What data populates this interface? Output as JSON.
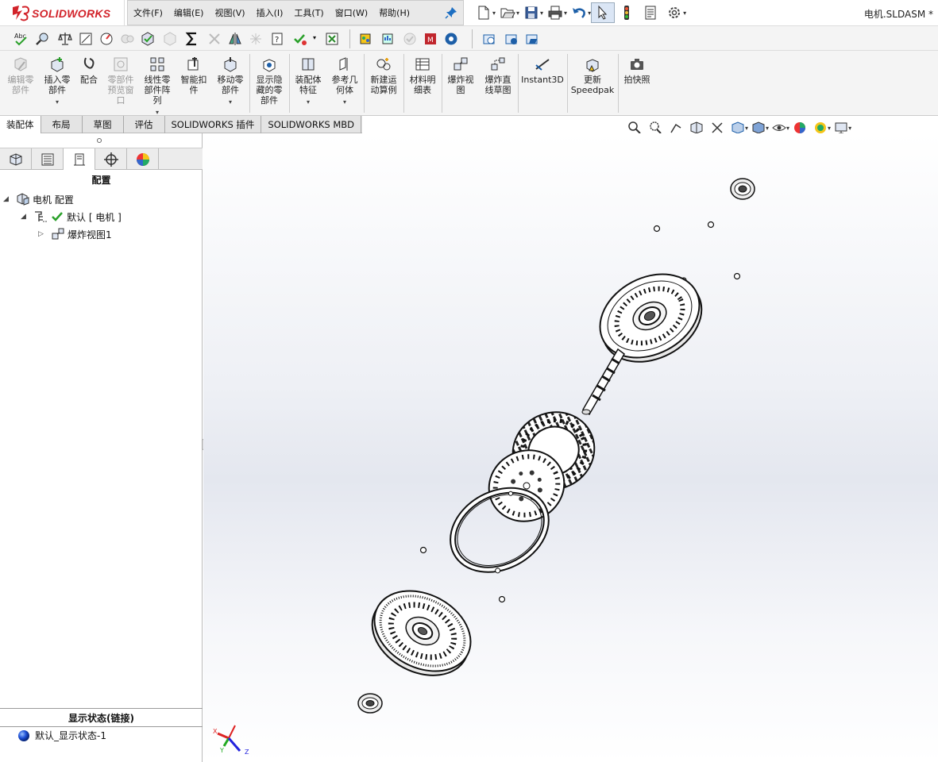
{
  "app": {
    "logo_text": "SOLIDWORKS",
    "document_title": "电机.SLDASM *"
  },
  "menu": [
    "文件(F)",
    "编辑(E)",
    "视图(V)",
    "插入(I)",
    "工具(T)",
    "窗口(W)",
    "帮助(H)"
  ],
  "quick_access": [
    "new-icon",
    "open-icon",
    "save-icon",
    "print-icon",
    "undo-icon",
    "select-icon",
    "rebuild-icon",
    "file-properties-icon",
    "options-icon"
  ],
  "ribbon": {
    "buttons": [
      {
        "label": "编辑零\n部件",
        "enabled": false
      },
      {
        "label": "插入零\n部件",
        "enabled": true,
        "dropdown": true
      },
      {
        "label": "配合",
        "enabled": true
      },
      {
        "label": "零部件\n预览窗\n口",
        "enabled": false
      },
      {
        "label": "线性零\n部件阵\n列",
        "enabled": true,
        "dropdown": true
      },
      {
        "label": "智能扣\n件",
        "enabled": true
      },
      {
        "label": "移动零\n部件",
        "enabled": true,
        "dropdown": true
      },
      {
        "label": "显示隐\n藏的零\n部件",
        "enabled": true
      },
      {
        "label": "装配体\n特征",
        "enabled": true,
        "dropdown": true
      },
      {
        "label": "参考几\n何体",
        "enabled": true,
        "dropdown": true
      },
      {
        "label": "新建运\n动算例",
        "enabled": true
      },
      {
        "label": "材料明\n细表",
        "enabled": true
      },
      {
        "label": "爆炸视\n图",
        "enabled": true
      },
      {
        "label": "爆炸直\n线草图",
        "enabled": true
      },
      {
        "label": "Instant3D",
        "enabled": true
      },
      {
        "label": "更新\nSpeedpak",
        "enabled": true
      },
      {
        "label": "拍快照",
        "enabled": true
      }
    ]
  },
  "tabs": [
    {
      "label": "装配体",
      "active": true
    },
    {
      "label": "布局",
      "active": false
    },
    {
      "label": "草图",
      "active": false
    },
    {
      "label": "评估",
      "active": false
    },
    {
      "label": "SOLIDWORKS 插件",
      "active": false
    },
    {
      "label": "SOLIDWORKS MBD",
      "active": false
    }
  ],
  "left_panel": {
    "tabs": [
      "feature-manager-icon",
      "property-manager-icon",
      "configuration-manager-icon",
      "dimxpert-icon",
      "display-manager-icon"
    ],
    "active_tab": 2,
    "title": "配置",
    "tree": [
      {
        "label": "电机 配置",
        "level": 0,
        "expanded": true,
        "icon": "assembly-icon"
      },
      {
        "label": "默认 [ 电机 ]",
        "level": 1,
        "expanded": true,
        "icon": "configuration-icon",
        "checked": true
      },
      {
        "label": "爆炸视图1",
        "level": 2,
        "expanded": false,
        "icon": "exploded-view-icon"
      }
    ],
    "display_state_title": "显示状态(链接)",
    "display_state_item": "默认_显示状态-1"
  },
  "colors": {
    "logo_red": "#d2232a",
    "accent_blue": "#1d6fc2",
    "status_green": "#2aa02a"
  }
}
